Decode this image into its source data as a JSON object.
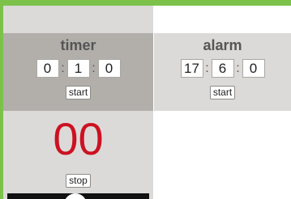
{
  "timer": {
    "title": "timer",
    "hours": "0",
    "minutes": "1",
    "seconds": "0",
    "separator": ":",
    "start_label": "start",
    "countdown": "00",
    "stop_label": "stop"
  },
  "alarm": {
    "title": "alarm",
    "hours": "17",
    "minutes": "6",
    "seconds": "0",
    "separator": ":",
    "start_label": "start"
  },
  "colors": {
    "countdown": "#cc1122",
    "timer_panel_active": "#b2afab",
    "panel": "#dcdad8",
    "page_background": "#7cc24a"
  }
}
